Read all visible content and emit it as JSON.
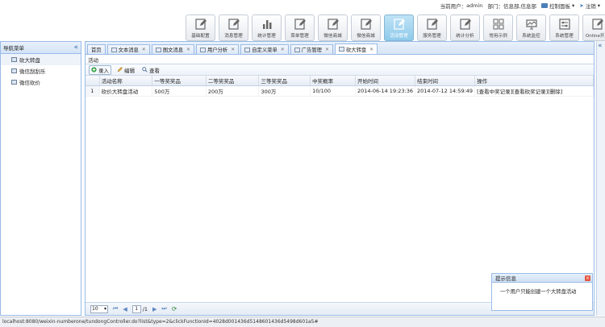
{
  "userbar": {
    "current_user_label": "当前用户：",
    "current_user": "admin",
    "dept_label": "部门：",
    "dept": "信息部,信息部",
    "control_panel": "控制面板",
    "logout": "注销"
  },
  "toolbar": [
    {
      "label": "基础配置",
      "icon": "edit-icon"
    },
    {
      "label": "消息管理",
      "icon": "edit-icon"
    },
    {
      "label": "统计管理",
      "icon": "bar-chart-icon"
    },
    {
      "label": "菜单管理",
      "icon": "edit-icon"
    },
    {
      "label": "微信商城",
      "icon": "edit-icon"
    },
    {
      "label": "微信商城",
      "icon": "edit-icon"
    },
    {
      "label": "活动管理",
      "icon": "edit-icon",
      "active": true
    },
    {
      "label": "服务管理",
      "icon": "edit-icon"
    },
    {
      "label": "统计分析",
      "icon": "edit-icon"
    },
    {
      "label": "常用示例",
      "icon": "grid-icon"
    },
    {
      "label": "系统监控",
      "icon": "monitor-icon"
    },
    {
      "label": "系统管理",
      "icon": "settings-icon"
    },
    {
      "label": "Online开发",
      "icon": "edit-icon"
    }
  ],
  "sidebar": {
    "title": "导航菜单",
    "items": [
      {
        "label": "砍大转盘",
        "selected": true
      },
      {
        "label": "微信刮刮乐"
      },
      {
        "label": "微信砍价"
      }
    ]
  },
  "tabs": [
    {
      "label": "首页",
      "closable": false
    },
    {
      "label": "文本消息",
      "closable": true
    },
    {
      "label": "图文消息",
      "closable": true
    },
    {
      "label": "用户分析",
      "closable": true
    },
    {
      "label": "自定义菜单",
      "closable": true
    },
    {
      "label": "广告管理",
      "closable": true
    },
    {
      "label": "砍大转盘",
      "closable": true,
      "active": true
    }
  ],
  "panel_title": "活动",
  "grid_toolbar": {
    "add": "录入",
    "edit": "编辑",
    "view": "查看"
  },
  "table": {
    "columns": [
      "活动名称",
      "一等奖奖品",
      "二等奖奖品",
      "三等奖奖品",
      "中奖概率",
      "开始时间",
      "结束时间",
      "操作"
    ],
    "rows": [
      {
        "num": "1",
        "cells": [
          "砍价大转盘活动",
          "500万",
          "200万",
          "300万",
          "10/100",
          "2014-06-14 19:23:36",
          "2014-07-12 14:59:49",
          "[查看中奖记录][查看砍奖记录][删除]"
        ]
      }
    ]
  },
  "pager": {
    "page_size": "10",
    "page": "1",
    "total_pages": "/1"
  },
  "popup": {
    "title": "提示信息",
    "message": "一个用户只能创建一个大转盘活动"
  },
  "statusbar": {
    "url": "localhost:8080/weixin-numberone/tundongController.do?list&type=2&clickFunctionId=4028d001436d5148601436d5498d601a5#"
  }
}
